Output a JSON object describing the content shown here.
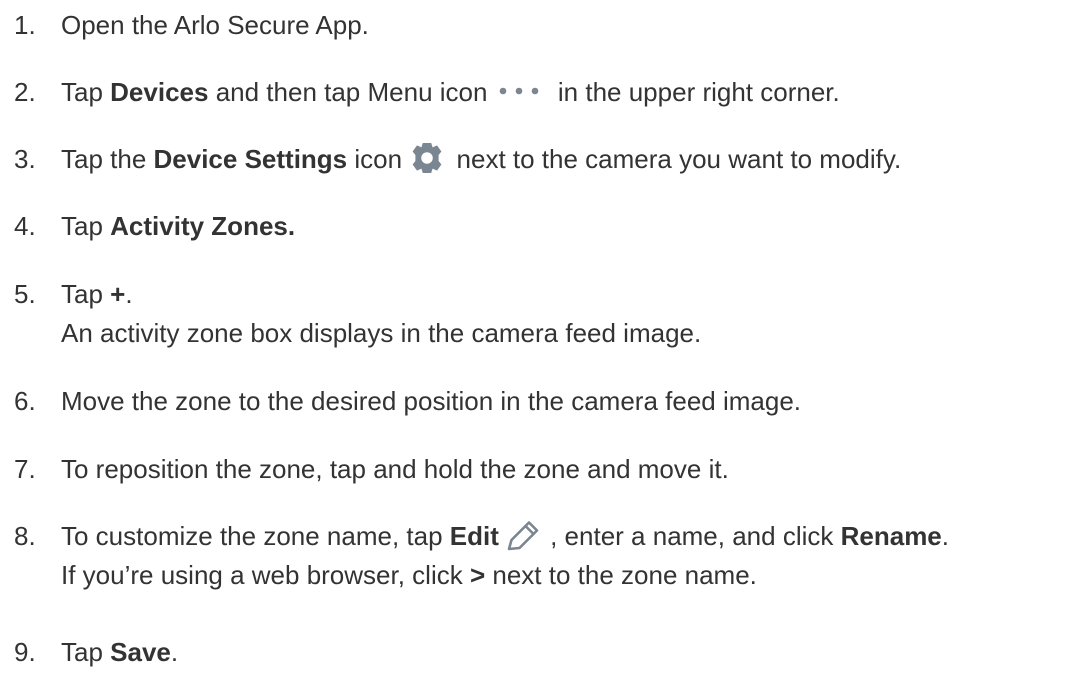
{
  "steps": [
    {
      "num": "1.",
      "line1": [
        "Open the Arlo Secure App."
      ]
    },
    {
      "num": "2.",
      "line1": [
        "Tap ",
        "Devices",
        " and then tap Menu icon ",
        " in the  upper right corner."
      ]
    },
    {
      "num": "3.",
      "line1": [
        "Tap the ",
        "Device Settings",
        " icon ",
        " next to the camera you want to modify."
      ]
    },
    {
      "num": "4.",
      "line1": [
        "Tap ",
        "Activity Zones."
      ]
    },
    {
      "num": "5.",
      "line1": [
        "Tap ",
        "+",
        "."
      ],
      "line2": "An activity zone box displays in the camera feed image."
    },
    {
      "num": "6.",
      "line1": [
        "Move the zone to the desired position in the camera feed image."
      ]
    },
    {
      "num": "7.",
      "line1": [
        "To reposition the zone, tap and hold the zone and move it."
      ]
    },
    {
      "num": "8.",
      "line1": [
        "To customize the zone name, tap ",
        "Edit",
        " , enter a name, and click ",
        "Rename",
        "."
      ],
      "line2": [
        "If you’re using a web browser, click ",
        ">",
        " next to the zone name."
      ]
    },
    {
      "num": "9.",
      "line1": [
        "Tap ",
        "Save",
        "."
      ]
    }
  ],
  "icons": {
    "menu": "more-horizontal-icon",
    "settings": "gear-icon",
    "edit": "pencil-icon",
    "icon_color": "#7a8691"
  }
}
